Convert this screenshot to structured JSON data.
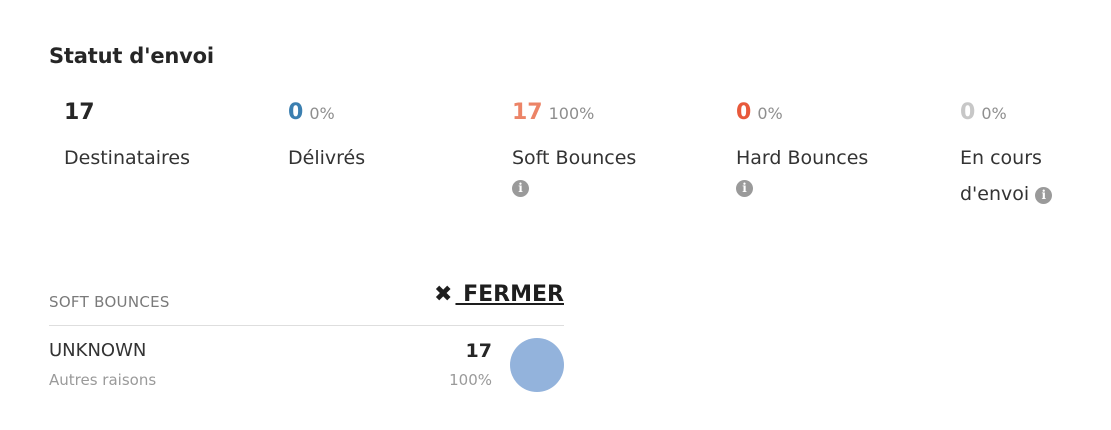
{
  "section_title": "Statut d'envoi",
  "stats": [
    {
      "value": "17",
      "percent": "",
      "label": "Destinataires",
      "color": "#262626",
      "has_info": false
    },
    {
      "value": "0",
      "percent": "0%",
      "label": "Délivrés",
      "color": "#3b7fb0",
      "has_info": false
    },
    {
      "value": "17",
      "percent": "100%",
      "label": "Soft Bounces",
      "color": "#ec8467",
      "has_info": true
    },
    {
      "value": "0",
      "percent": "0%",
      "label": "Hard Bounces",
      "color": "#e8593b",
      "has_info": true
    },
    {
      "value": "0",
      "percent": "0%",
      "label": "En cours d'envoi",
      "color": "#c7c7c7",
      "has_info": true
    }
  ],
  "info_icon": "info-circle-icon",
  "bounce_panel": {
    "title": "SOFT BOUNCES",
    "close_label": " FERMER",
    "close_icon": "✖",
    "rows": [
      {
        "name": "UNKNOWN",
        "description": "Autres raisons",
        "count": "17",
        "percent": "100%",
        "color": "#93b3dc"
      }
    ]
  }
}
